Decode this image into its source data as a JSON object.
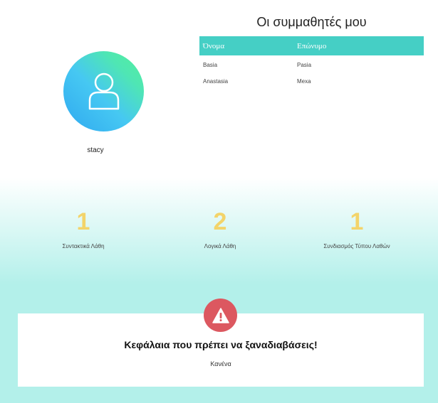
{
  "profile": {
    "username": "stacy",
    "avatar_icon": "user-icon"
  },
  "classmates": {
    "title": "Οι συμμαθητές μου",
    "headers": {
      "first_name": "Όνομα",
      "last_name": "Επώνυμο"
    },
    "rows": [
      {
        "first_name": "Basia",
        "last_name": "Pasia"
      },
      {
        "first_name": "Anastasia",
        "last_name": "Mexa"
      }
    ]
  },
  "stats": [
    {
      "value": "1",
      "label": "Συντακτικά Λάθη"
    },
    {
      "value": "2",
      "label": "Λογικά Λάθη"
    },
    {
      "value": "1",
      "label": "Συνδιασμός Τύπου Λαθών"
    }
  ],
  "review": {
    "icon": "warning-icon",
    "title": "Κεφάλαια που πρέπει να ξαναδιαβάσεις!",
    "body": "Κανένα"
  },
  "colors": {
    "accent": "#45cfc5",
    "number": "#f3d46a",
    "warning": "#dc5860"
  }
}
